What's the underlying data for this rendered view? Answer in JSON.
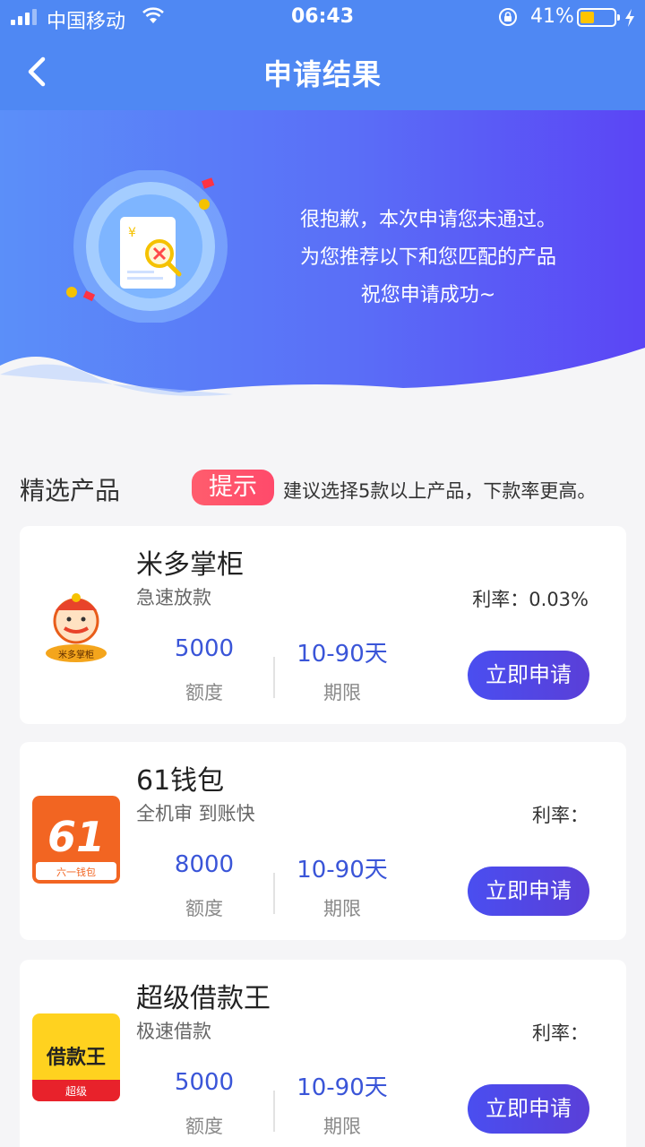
{
  "status_bar": {
    "carrier": "中国移动",
    "time": "06:43",
    "battery_pct": "41%",
    "battery_level": 0.41,
    "battery_color": "#ffc400"
  },
  "nav": {
    "title": "申请结果",
    "back_icon": "chevron-left-icon"
  },
  "banner": {
    "line1": "很抱歉，本次申请您未通过。",
    "line2": "为您推荐以下和您匹配的产品",
    "line3": "祝您申请成功~",
    "doc_symbol": "¥"
  },
  "section": {
    "title": "精选产品",
    "tip_label": "提示",
    "tip_text": "建议选择5款以上产品，下款率更高。"
  },
  "labels": {
    "amount": "额度",
    "term": "期限",
    "apply": "立即申请"
  },
  "products": [
    {
      "name": "米多掌柜",
      "tagline": "急速放款",
      "rate": "利率：0.03%",
      "amount": "5000",
      "term": "10-90天",
      "logo_text": "米多掌柜"
    },
    {
      "name": "61钱包",
      "tagline": "全机审 到账快",
      "rate": "利率：",
      "amount": "8000",
      "term": "10-90天",
      "logo_text": "61",
      "logo_sub": "六一钱包"
    },
    {
      "name": "超级借款王",
      "tagline": "极速借款",
      "rate": "利率：",
      "amount": "5000",
      "term": "10-90天",
      "logo_text": "借款王",
      "logo_sub": "超级"
    }
  ],
  "colors": {
    "primary": "#4f88f3",
    "accent_blue": "#3a55d8",
    "tip_red": "#ff4a6b"
  }
}
